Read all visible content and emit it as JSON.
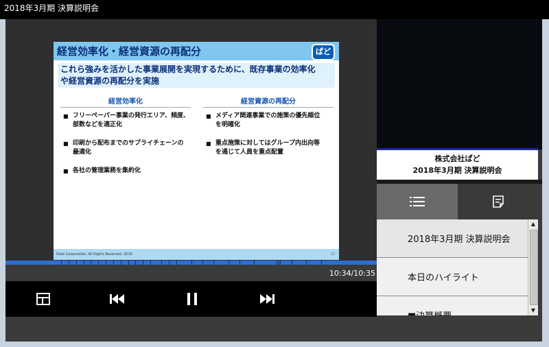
{
  "window": {
    "title": "2018年3月期 決算説明会"
  },
  "slide": {
    "title": "経営効率化・経営資源の再配分",
    "logo": "ぱど",
    "subtitle_line1": "これら強みを活かした事業展開を実現するために、既存事業の効率化",
    "subtitle_line2": "や経営資源の再配分を実施",
    "left_heading": "経営効率化",
    "left_items": [
      {
        "line1": "フリーペーパー事業の発行エリア、頻度、",
        "line2": "部数などを適正化"
      },
      {
        "line1": "印刷から配布までのサプライチェーンの",
        "line2": "最適化"
      },
      {
        "line1": "各社の管理業務を集約化",
        "line2": ""
      }
    ],
    "right_heading": "経営資源の再配分",
    "right_items": [
      {
        "line1": "メディア関連事業での施策の優先順位",
        "line2": "を明確化"
      },
      {
        "line1": "重点施策に対してはグループ内出向等",
        "line2": "を通じて人員を重点配置"
      }
    ],
    "footer": "Pado Corporation, All Rights Reserved, 2018",
    "page": "20"
  },
  "caption": {
    "company": "株式会社ぱど",
    "event": "2018年3月期 決算説明会"
  },
  "tabs": {
    "list_icon": "list-icon",
    "notes_icon": "notes-icon"
  },
  "chapters": [
    {
      "label": "2018年3月期 決算説明会"
    },
    {
      "label": "本日のハイライト"
    },
    {
      "label": "■決算概要"
    }
  ],
  "player": {
    "time": "10:34/10:35",
    "progress": 0.999,
    "chapter_marks": [
      0.15,
      0.17,
      0.19,
      0.21,
      0.23,
      0.25,
      0.27,
      0.29,
      0.31,
      0.33,
      0.35,
      0.37,
      0.39,
      0.42,
      0.44,
      0.46,
      0.5,
      0.53,
      0.56,
      0.6,
      0.63,
      0.67,
      0.73,
      0.735,
      0.74,
      0.77,
      0.81,
      0.85
    ],
    "controls": [
      "layout-icon",
      "skip-back-icon",
      "pause-icon",
      "skip-forward-icon"
    ]
  },
  "colors": {
    "accent": "#2c6fd6",
    "slide_header": "#7fc7ef",
    "slide_title": "#0b2e7a"
  }
}
